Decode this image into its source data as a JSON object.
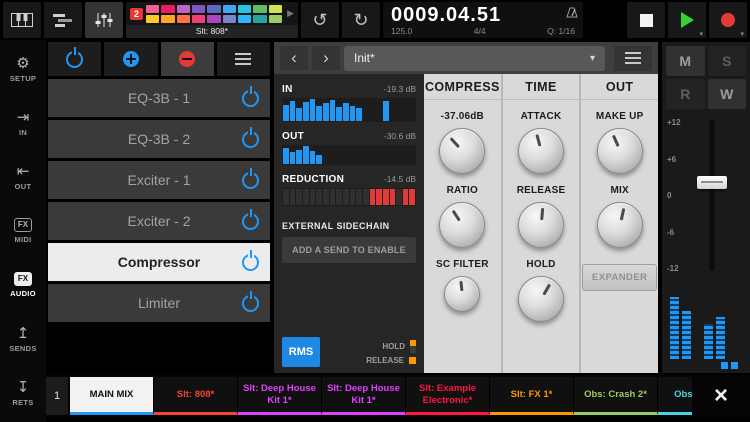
{
  "icons": {
    "undo": "↺",
    "redo": "↻",
    "caret_down": "▾",
    "play_small": "▶",
    "chevron_left": "‹",
    "chevron_right": "›",
    "close": "×"
  },
  "topbar": {
    "pattern": {
      "badge": "2",
      "slot_label": "Slt: 808*",
      "colors": [
        "#f06292",
        "#e91e63",
        "#ba68c8",
        "#7e57c2",
        "#5c6bc0",
        "#42a5f5",
        "#26c6da",
        "#66bb6a",
        "#d4e157",
        "#ffca28",
        "#ffa726",
        "#ff7043",
        "#ec407a",
        "#ab47bc",
        "#7986cb",
        "#29b6f6",
        "#26a69a",
        "#9ccc65"
      ]
    },
    "time": "0009.04.51",
    "tempo": "125.0",
    "signature": "4/4",
    "quantize": "Q: 1/16"
  },
  "sidebar": {
    "items": [
      {
        "label": "SETUP",
        "icon": "⚙"
      },
      {
        "label": "IN",
        "icon": "⇥"
      },
      {
        "label": "OUT",
        "icon": "⇤"
      },
      {
        "label": "MIDI",
        "icon": "FX"
      },
      {
        "label": "AUDIO",
        "icon": "FX"
      },
      {
        "label": "SENDS",
        "icon": "↥"
      },
      {
        "label": "RETS",
        "icon": "↧"
      }
    ]
  },
  "fx_chain": {
    "items": [
      {
        "label": "EQ-3B - 1"
      },
      {
        "label": "EQ-3B - 2"
      },
      {
        "label": "Exciter - 1"
      },
      {
        "label": "Exciter - 2"
      },
      {
        "label": "Compressor"
      },
      {
        "label": "Limiter"
      }
    ]
  },
  "plugin": {
    "preset": "Init*",
    "meters": [
      {
        "id": "in",
        "label": "IN",
        "value": "-19.3 dB",
        "mode": "level",
        "color": "#2196f3",
        "bars": [
          0.75,
          0.9,
          0.6,
          0.85,
          1,
          0.7,
          0.8,
          0.95,
          0.65,
          0.8,
          0.7,
          0.6,
          0,
          0,
          0,
          0.9,
          0,
          0,
          0,
          0
        ]
      },
      {
        "id": "out",
        "label": "OUT",
        "value": "-30.6 dB",
        "mode": "level",
        "color": "#2196f3",
        "bars": [
          0.9,
          0.65,
          0.8,
          1,
          0.7,
          0.5,
          0,
          0,
          0,
          0,
          0,
          0,
          0,
          0,
          0,
          0,
          0,
          0,
          0,
          0
        ]
      },
      {
        "id": "reduction",
        "label": "REDUCTION",
        "value": "-14.5 dB",
        "mode": "state",
        "color": "#e53935",
        "bars": [
          0,
          0,
          0,
          0,
          0,
          0,
          0,
          0,
          0,
          0,
          0,
          0,
          0,
          1,
          1,
          1,
          1,
          0,
          1,
          1
        ]
      }
    ],
    "sidechain": {
      "label": "EXTERNAL SIDECHAIN",
      "button": "ADD A SEND TO ENABLE"
    },
    "detector": {
      "rms": "RMS",
      "hold": "HOLD",
      "release": "RELEASE"
    },
    "columns": [
      {
        "title": "COMPRESS",
        "knobs": [
          {
            "label": "-37.06dB"
          },
          {
            "label": "RATIO"
          },
          {
            "label": "SC FILTER"
          }
        ]
      },
      {
        "title": "TIME",
        "knobs": [
          {
            "label": "ATTACK"
          },
          {
            "label": "RELEASE"
          },
          {
            "label": "HOLD"
          }
        ]
      },
      {
        "title": "OUT",
        "knobs": [
          {
            "label": "MAKE UP"
          },
          {
            "label": "MIX"
          }
        ],
        "button": "EXPANDER"
      }
    ]
  },
  "mixer": {
    "mute": "M",
    "solo": "S",
    "read": "R",
    "write": "W",
    "scale": [
      "+12",
      "+6",
      "0",
      "-6",
      "-12"
    ],
    "meter_levels": [
      0.88,
      0.68,
      0.5,
      0.6
    ]
  },
  "trackbar": {
    "index": "1",
    "tabs": [
      {
        "label": "MAIN MIX",
        "color": "#2196f3",
        "selected": true
      },
      {
        "label": "Slt: 808*",
        "color": "#f44336"
      },
      {
        "label": "Slt: Deep House Kit 1*",
        "color": "#e040fb"
      },
      {
        "label": "Slt: Deep House Kit 1*",
        "color": "#e040fb"
      },
      {
        "label": "Slt: Example Electronic*",
        "color": "#ff1744"
      },
      {
        "label": "Slt: FX 1*",
        "color": "#ff9800"
      },
      {
        "label": "Obs: Crash 2*",
        "color": "#9ccc65"
      },
      {
        "label": "Obs: Alien*",
        "color": "#4dd0e1"
      }
    ]
  }
}
